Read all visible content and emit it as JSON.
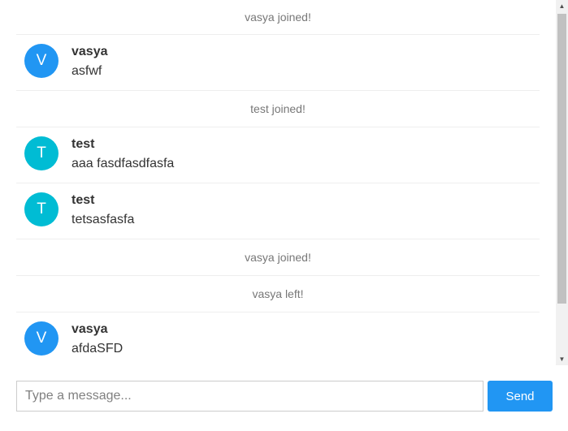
{
  "messages": [
    {
      "kind": "event",
      "text": "vasya joined!"
    },
    {
      "kind": "chat",
      "initial": "V",
      "color": "#2196f3",
      "user": "vasya",
      "text": "asfwf"
    },
    {
      "kind": "event",
      "text": "test joined!"
    },
    {
      "kind": "chat",
      "initial": "T",
      "color": "#00bcd4",
      "user": "test",
      "text": "aaa fasdfasdfasfa"
    },
    {
      "kind": "chat",
      "initial": "T",
      "color": "#00bcd4",
      "user": "test",
      "text": "tetsasfasfa"
    },
    {
      "kind": "event",
      "text": "vasya joined!"
    },
    {
      "kind": "event",
      "text": "vasya left!"
    },
    {
      "kind": "chat",
      "initial": "V",
      "color": "#2196f3",
      "user": "vasya",
      "text": "afdaSFD"
    }
  ],
  "composer": {
    "placeholder": "Type a message...",
    "value": "",
    "send_label": "Send"
  },
  "colors": {
    "accent": "#2196f3",
    "avatar_v": "#2196f3",
    "avatar_t": "#00bcd4"
  }
}
